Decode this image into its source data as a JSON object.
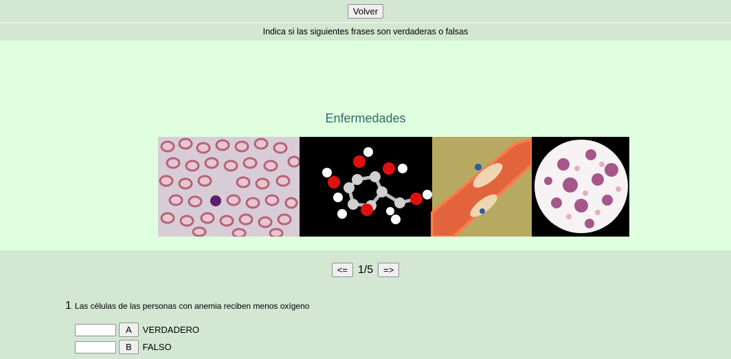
{
  "header": {
    "back_label": "Volver"
  },
  "instruction": "Indica si las siguientes frases son verdaderas o falsas",
  "main": {
    "title": "Enfermedades",
    "images": [
      "blood-smear-image",
      "molecule-image",
      "blood-vessel-image",
      "leukemia-cells-image"
    ]
  },
  "pagination": {
    "prev_label": "<=",
    "next_label": "=>",
    "current": "1/5"
  },
  "question": {
    "number": "1",
    "text": "Las células de las personas con anemia reciben menos oxígeno",
    "options": [
      {
        "letter": "A",
        "label": "VERDADERO",
        "value": ""
      },
      {
        "letter": "B",
        "label": "FALSO",
        "value": ""
      }
    ]
  },
  "colors": {
    "page_background": "#d3e7d3",
    "content_background": "#dfffdf",
    "title_color": "#2f6a6a"
  }
}
